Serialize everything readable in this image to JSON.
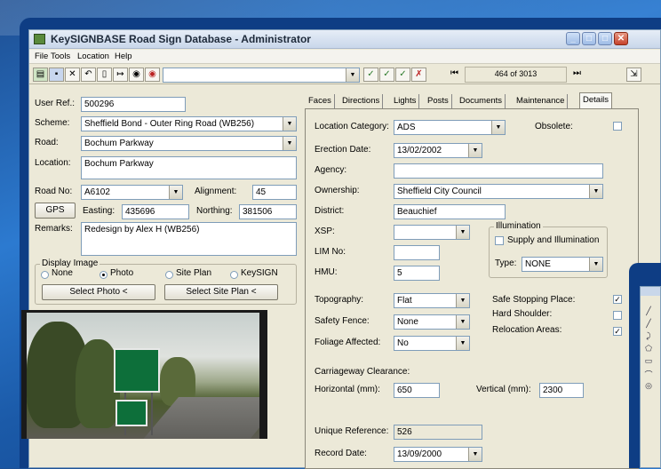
{
  "window": {
    "title": "KeySIGNBASE Road Sign Database - Administrator"
  },
  "menu": [
    "File",
    "Tools",
    "Location",
    "Help"
  ],
  "toolbar": {
    "record_counter": "464 of 3013",
    "first_icon": "first-record-icon",
    "last_icon": "last-record-icon"
  },
  "left": {
    "user_ref_label": "User Ref.:",
    "user_ref": "500296",
    "scheme_label": "Scheme:",
    "scheme": "Sheffield Bond - Outer Ring Road (WB256)",
    "road_label": "Road:",
    "road": "Bochum Parkway",
    "location_label": "Location:",
    "location": "Bochum Parkway",
    "road_no_label": "Road No:",
    "road_no": "A6102",
    "alignment_label": "Alignment:",
    "alignment": "45",
    "gps_label": "GPS",
    "easting_label": "Easting:",
    "easting": "435696",
    "northing_label": "Northing:",
    "northing": "381506",
    "remarks_label": "Remarks:",
    "remarks": "Redesign by Alex H (WB256)",
    "display_image_label": "Display Image",
    "radio_none": "None",
    "radio_photo": "Photo",
    "radio_site_plan": "Site Plan",
    "radio_keysign": "KeySIGN",
    "select_photo": "Select Photo <",
    "select_site_plan": "Select Site Plan <"
  },
  "tabs": [
    "Faces",
    "Directions",
    "Lights",
    "Posts",
    "Documents",
    "Maintenance",
    "Details"
  ],
  "details": {
    "location_category_label": "Location Category:",
    "location_category": "ADS",
    "obsolete_label": "Obsolete:",
    "erection_date_label": "Erection Date:",
    "erection_date": "13/02/2002",
    "agency_label": "Agency:",
    "agency": "",
    "ownership_label": "Ownership:",
    "ownership": "Sheffield City Council",
    "district_label": "District:",
    "district": "Beauchief",
    "xsp_label": "XSP:",
    "illumination_label": "Illumination",
    "supply_label": "Supply and Illumination",
    "lim_label": "LIM No:",
    "hmu_label": "HMU:",
    "hmu": "5",
    "type_label": "Type:",
    "type": "NONE",
    "topography_label": "Topography:",
    "topography": "Flat",
    "safe_stopping_label": "Safe Stopping Place:",
    "safety_fence_label": "Safety Fence:",
    "safety_fence": "None",
    "hard_shoulder_label": "Hard Shoulder:",
    "relocation_label": "Relocation Areas:",
    "foliage_label": "Foliage Affected:",
    "foliage": "No",
    "clearance_label": "Carriageway Clearance:",
    "horizontal_label": "Horizontal (mm):",
    "horizontal": "650",
    "vertical_label": "Vertical (mm):",
    "vertical": "2300",
    "unique_ref_label": "Unique Reference:",
    "unique_ref": "526",
    "record_date_label": "Record Date:",
    "record_date": "13/09/2000"
  }
}
